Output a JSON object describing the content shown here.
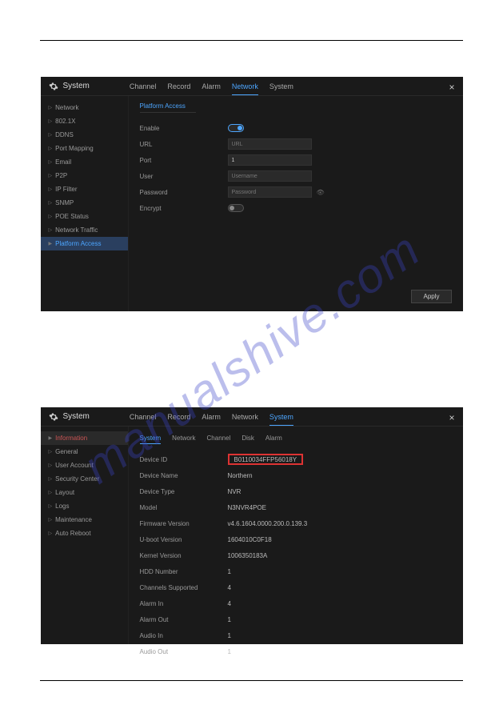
{
  "watermark": "manualshive.com",
  "panel1": {
    "title": "System",
    "tabs": [
      "Channel",
      "Record",
      "Alarm",
      "Network",
      "System"
    ],
    "active_tab": 3,
    "sidebar": [
      {
        "label": "Network"
      },
      {
        "label": "802.1X"
      },
      {
        "label": "DDNS"
      },
      {
        "label": "Port Mapping"
      },
      {
        "label": "Email"
      },
      {
        "label": "P2P"
      },
      {
        "label": "IP Filter"
      },
      {
        "label": "SNMP"
      },
      {
        "label": "POE Status"
      },
      {
        "label": "Network Traffic"
      },
      {
        "label": "Platform Access"
      }
    ],
    "active_sidebar": 10,
    "subtitle": "Platform Access",
    "form": {
      "enable_label": "Enable",
      "url_label": "URL",
      "url_placeholder": "URL",
      "port_label": "Port",
      "port_value": "1",
      "user_label": "User",
      "user_placeholder": "Username",
      "password_label": "Password",
      "password_placeholder": "Password",
      "encrypt_label": "Encrypt"
    },
    "apply_label": "Apply"
  },
  "panel2": {
    "title": "System",
    "tabs": [
      "Channel",
      "Record",
      "Alarm",
      "Network",
      "System"
    ],
    "active_tab": 4,
    "sidebar": [
      {
        "label": "Information"
      },
      {
        "label": "General"
      },
      {
        "label": "User Account"
      },
      {
        "label": "Security Center"
      },
      {
        "label": "Layout"
      },
      {
        "label": "Logs"
      },
      {
        "label": "Maintenance"
      },
      {
        "label": "Auto Reboot"
      }
    ],
    "active_sidebar": 0,
    "subtabs": [
      "System",
      "Network",
      "Channel",
      "Disk",
      "Alarm"
    ],
    "active_subtab": 0,
    "rows": [
      {
        "label": "Device ID",
        "value": "B0110034FFP56018Y",
        "highlight": true
      },
      {
        "label": "Device Name",
        "value": "Northern"
      },
      {
        "label": "Device Type",
        "value": "NVR"
      },
      {
        "label": "Model",
        "value": "N3NVR4POE"
      },
      {
        "label": "Firmware Version",
        "value": "v4.6.1604.0000.200.0.139.3"
      },
      {
        "label": "U-boot Version",
        "value": "1604010C0F18"
      },
      {
        "label": "Kernel Version",
        "value": "1006350183A"
      },
      {
        "label": "HDD Number",
        "value": "1"
      },
      {
        "label": "Channels Supported",
        "value": "4"
      },
      {
        "label": "Alarm In",
        "value": "4"
      },
      {
        "label": "Alarm Out",
        "value": "1"
      },
      {
        "label": "Audio In",
        "value": "1"
      },
      {
        "label": "Audio Out",
        "value": "1"
      }
    ]
  }
}
